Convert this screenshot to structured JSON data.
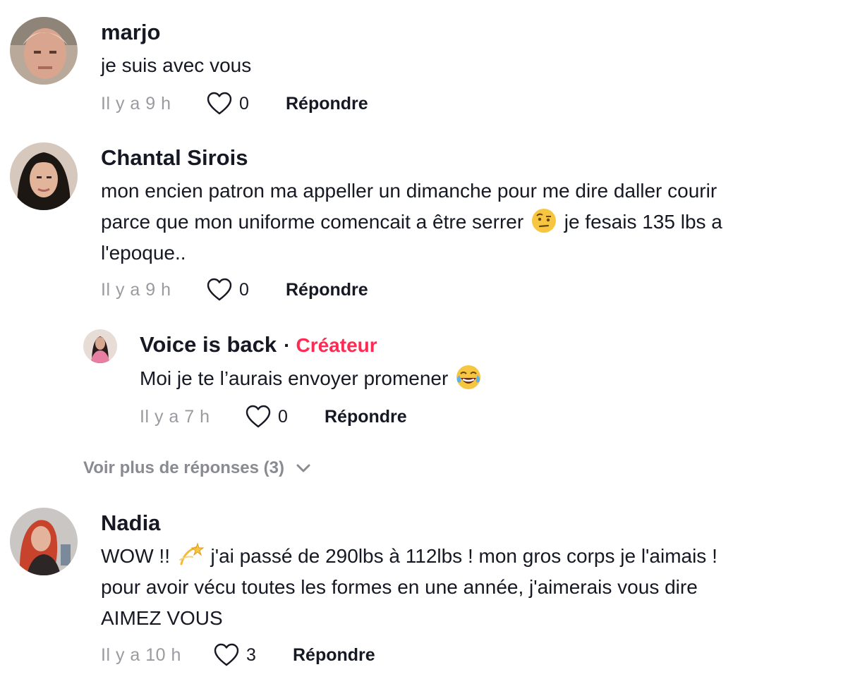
{
  "comments": [
    {
      "username": "marjo",
      "text": "je suis avec vous",
      "time": "Il y a 9 h",
      "likes": "0",
      "reply_label": "Répondre"
    },
    {
      "username": "Chantal Sirois",
      "text_line1": "mon encien patron ma appeller un dimanche pour me dire daller courir",
      "text_line2a": "parce que mon uniforme comencait a être serrer",
      "emoji": "face-with-raised-eyebrow-emoji",
      "text_line2b": "je fesais 135 lbs a",
      "text_line3": "l'epoque..",
      "time": "Il y a 9 h",
      "likes": "0",
      "reply_label": "Répondre"
    },
    {
      "username": "Voice is back",
      "separator": "·",
      "badge": "Créateur",
      "text": "Moi je te l’aurais envoyer promener",
      "emoji": "face-with-tears-of-joy-emoji",
      "time": "Il y a 7 h",
      "likes": "0",
      "reply_label": "Répondre"
    },
    {
      "username": "Nadia",
      "text_line1a": "WOW !!",
      "emoji": "dizzy-emoji",
      "text_line1b": "j'ai passé de 290lbs à 112lbs ! mon gros corps je l'aimais !",
      "text_line2": "pour avoir vécu toutes les formes en une année, j'aimerais vous dire",
      "text_line3": "AIMEZ VOUS",
      "time": "Il y a 10 h",
      "likes": "3",
      "reply_label": "Répondre"
    }
  ],
  "more_replies": "Voir plus de réponses (3)",
  "colors": {
    "text": "#161823",
    "muted": "#9a9ba0",
    "creator_badge": "#fe2c55"
  }
}
